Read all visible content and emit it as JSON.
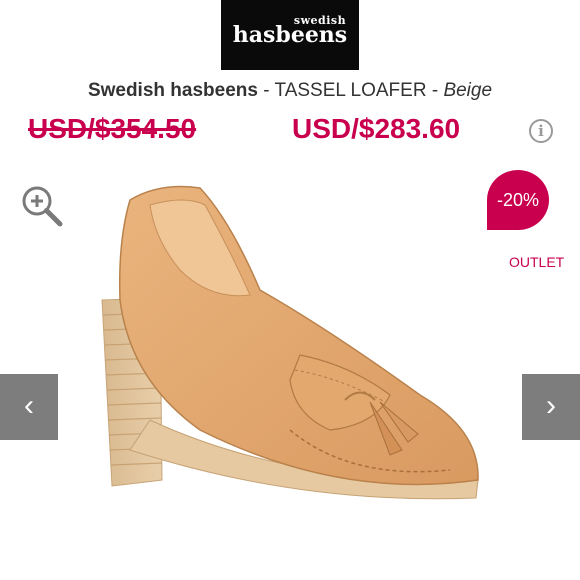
{
  "logo": {
    "line1": "swedish",
    "line2": "hasbeens"
  },
  "product": {
    "brand": "Swedish hasbeens",
    "separator1": " - ",
    "model": "TASSEL LOAFER",
    "separator2": " - ",
    "color": "Beige"
  },
  "pricing": {
    "old_price": "USD/$354.50",
    "new_price": "USD/$283.60",
    "discount_badge": "-20%",
    "outlet_label": "OUTLET",
    "accent_color": "#c8004d"
  },
  "icons": {
    "info": "info-icon",
    "zoom": "zoom-in-icon",
    "prev": "chevron-left-icon",
    "next": "chevron-right-icon"
  },
  "nav": {
    "prev_glyph": "‹",
    "next_glyph": "›"
  }
}
